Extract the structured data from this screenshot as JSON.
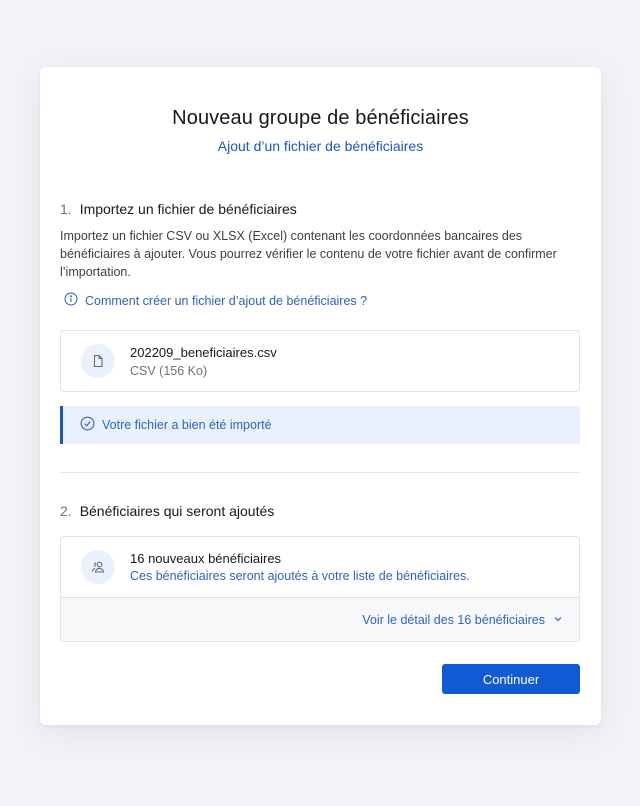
{
  "header": {
    "title": "Nouveau groupe de bénéficiaires",
    "subtitle": "Ajout d’un fichier de bénéficiaires"
  },
  "step1": {
    "number": "1.",
    "title": "Importez un fichier de bénéficiaires",
    "description": "Importez un fichier CSV ou XLSX (Excel) contenant les coordonnées bancaires des bénéficiaires à ajouter. Vous pourrez vérifier le contenu de votre fichier avant de confirmer l’importation.",
    "help_link": "Comment créer un fichier d’ajout de bénéficiaires ?",
    "file": {
      "name": "202209_beneficiaires.csv",
      "meta": "CSV (156 Ko)",
      "icon": "file-icon"
    },
    "success_message": "Votre fichier a bien été importé"
  },
  "step2": {
    "number": "2.",
    "title": "Bénéficiaires qui seront ajoutés",
    "count_label": "16 nouveaux bénéficiaires",
    "note": "Ces bénéficiaires seront ajoutés à votre liste de bénéficiaires.",
    "detail_link": "Voir le détail des 16 bénéficiaires",
    "icon": "users-icon"
  },
  "actions": {
    "continue_label": "Continuer"
  },
  "colors": {
    "accent": "#1259d4",
    "link": "#2f63c0",
    "success_bg": "#e9f1fc",
    "page_bg": "#f1f3f7"
  }
}
